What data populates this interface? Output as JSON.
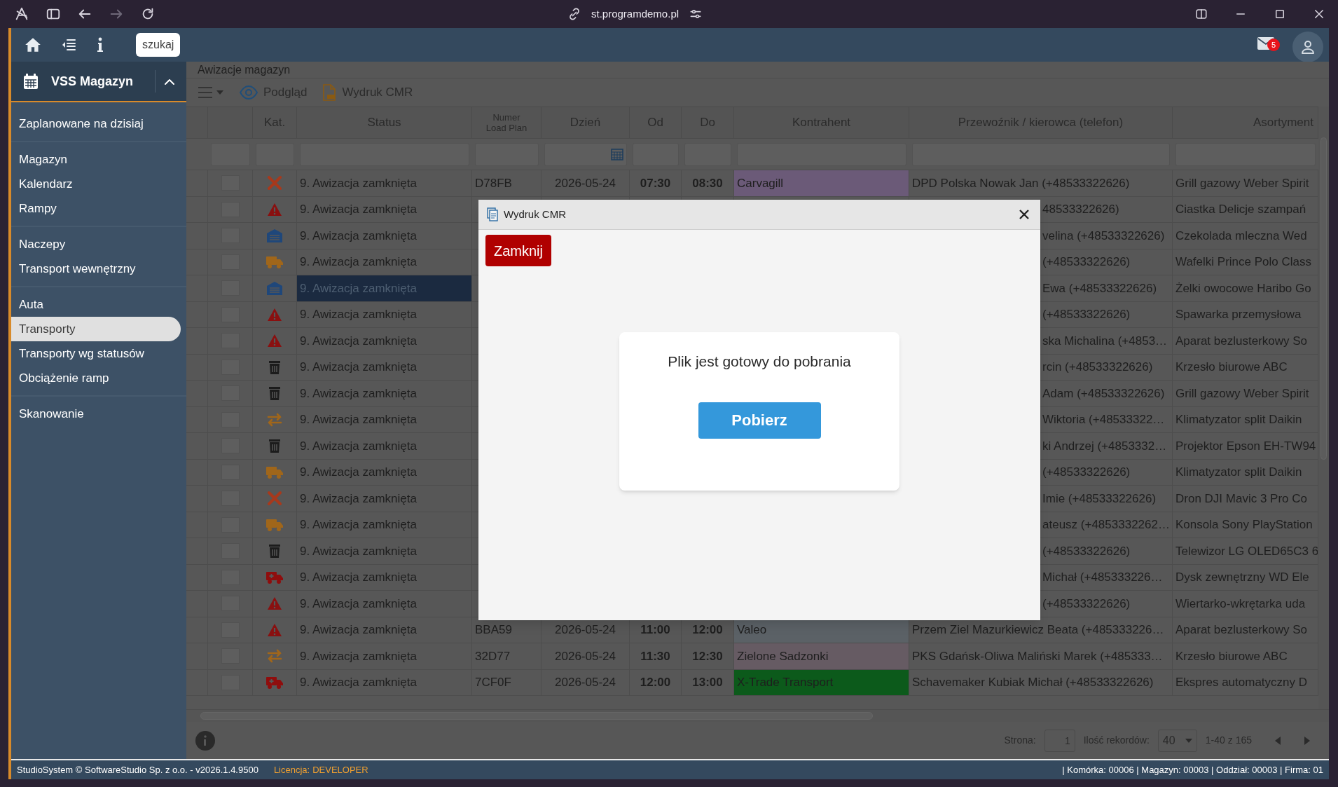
{
  "browser": {
    "url": "st.programdemo.pl"
  },
  "topbar": {
    "search_button": "szukaj",
    "mail_badge": "5"
  },
  "sidebar": {
    "title": "VSS Magazyn",
    "expanded": true,
    "groups": [
      [
        {
          "label": "Zaplanowane na dzisiaj",
          "selected": false
        }
      ],
      [
        {
          "label": "Magazyn",
          "selected": false
        },
        {
          "label": "Kalendarz",
          "selected": false
        },
        {
          "label": "Rampy",
          "selected": false
        }
      ],
      [
        {
          "label": "Naczepy",
          "selected": false
        },
        {
          "label": "Transport wewnętrzny",
          "selected": false
        }
      ],
      [
        {
          "label": "Auta",
          "selected": false
        },
        {
          "label": "Transporty",
          "selected": true
        },
        {
          "label": "Transporty wg statusów",
          "selected": false
        },
        {
          "label": "Obciążenie ramp",
          "selected": false
        }
      ],
      [
        {
          "label": "Skanowanie",
          "selected": false
        }
      ]
    ]
  },
  "page": {
    "title": "Awizacje magazyn",
    "toolbar": [
      {
        "kind": "eye",
        "label": "Podgląd"
      },
      {
        "kind": "pdf",
        "label": "Wydruk CMR"
      }
    ]
  },
  "table": {
    "columns": [
      "Kat.",
      "Status",
      "Numer Load Plan",
      "Dzień",
      "Od",
      "Do",
      "Kontrahent",
      "Przewoźnik / kierowca (telefon)",
      "Asortyment"
    ],
    "rows": [
      {
        "kind": "tools",
        "checked": false,
        "status": "9. Awizacja zamknięta",
        "selected": false,
        "numer": "D78FB",
        "dzien": "2026-05-24",
        "od": "07:30",
        "do": "08:30",
        "kontrahent": {
          "name": "Carvagill",
          "color": "#6b5a78"
        },
        "przewoznik": "DPD Polska Nowak Jan (+48533322626)",
        "asortyment": "Grill gazowy Weber Spirit"
      },
      {
        "kind": "warning",
        "checked": false,
        "status": "9. Awizacja zamknięta",
        "selected": false,
        "przewoznik": "48533322626)",
        "asortyment": "Ciastka Delicje szampań"
      },
      {
        "kind": "garage",
        "checked": false,
        "status": "9. Awizacja zamknięta",
        "selected": false,
        "przewoznik": "velina (+48533322626)",
        "asortyment": "Czekolada mleczna Wed"
      },
      {
        "kind": "truck",
        "checked": false,
        "status": "9. Awizacja zamknięta",
        "selected": false,
        "przewoznik": "(+48533322626)",
        "asortyment": "Wafelki Prince Polo Class"
      },
      {
        "kind": "garage",
        "checked": false,
        "status": "9. Awizacja zamknięta",
        "selected": true,
        "przewoznik": "Ewa (+48533322626)",
        "asortyment": "Żelki owocowe Haribo Go"
      },
      {
        "kind": "warning",
        "checked": false,
        "status": "9. Awizacja zamknięta",
        "selected": false,
        "przewoznik": "(+48533322626)",
        "asortyment": "Spawarka przemysłowa"
      },
      {
        "kind": "warning",
        "checked": false,
        "status": "9. Awizacja zamknięta",
        "selected": false,
        "przewoznik": "ska Michalina (+4853…",
        "asortyment": "Aparat bezlusterkowy So"
      },
      {
        "kind": "trash",
        "checked": false,
        "status": "9. Awizacja zamknięta",
        "selected": false,
        "przewoznik": "rcin (+48533322626)",
        "asortyment": "Krzesło biurowe ABC"
      },
      {
        "kind": "trash",
        "checked": false,
        "status": "9. Awizacja zamknięta",
        "selected": false,
        "przewoznik": "Adam (+48533322626)",
        "asortyment": "Grill gazowy Weber Spirit"
      },
      {
        "kind": "arrows",
        "checked": false,
        "status": "9. Awizacja zamknięta",
        "selected": false,
        "przewoznik": "Wiktoria (+48533322…",
        "asortyment": "Klimatyzator split Daikin"
      },
      {
        "kind": "trash",
        "checked": false,
        "status": "9. Awizacja zamknięta",
        "selected": false,
        "przewoznik": "ki Andrzej (+4853332…",
        "asortyment": "Projektor Epson EH-TW94"
      },
      {
        "kind": "truck",
        "checked": false,
        "status": "9. Awizacja zamknięta",
        "selected": false,
        "przewoznik": "(+48533322626)",
        "asortyment": "Klimatyzator split Daikin"
      },
      {
        "kind": "tools",
        "checked": false,
        "status": "9. Awizacja zamknięta",
        "selected": false,
        "przewoznik": "Imie (+48533322626)",
        "asortyment": "Dron DJI Mavic 3 Pro Co"
      },
      {
        "kind": "truck",
        "checked": false,
        "status": "9. Awizacja zamknięta",
        "selected": false,
        "przewoznik": "ateusz (+4853332262…",
        "asortyment": "Konsola Sony PlayStation"
      },
      {
        "kind": "trash",
        "checked": false,
        "status": "9. Awizacja zamknięta",
        "selected": false,
        "przewoznik": "(+48533322626)",
        "asortyment": "Telewizor LG OLED65C3 6"
      },
      {
        "kind": "ambulance",
        "checked": false,
        "status": "9. Awizacja zamknięta",
        "selected": false,
        "przewoznik": "Michał (+485333226…",
        "asortyment": "Dysk zewnętrzny WD Ele"
      },
      {
        "kind": "warning",
        "checked": false,
        "status": "9. Awizacja zamknięta",
        "selected": false,
        "przewoznik": "(+48533322626)",
        "asortyment": "Wiertarko-wkrętarka uda"
      },
      {
        "kind": "warning",
        "checked": false,
        "status": "9. Awizacja zamknięta",
        "selected": false,
        "numer": "BBA59",
        "dzien": "2026-05-24",
        "od": "11:00",
        "do": "12:00",
        "kontrahent": {
          "name": "Valeo",
          "color": "#5b6166"
        },
        "przewoznik": "Przem Ziel Mazurkiewicz Beata (+485333226…",
        "asortyment": "Aparat bezlusterkowy So"
      },
      {
        "kind": "arrows",
        "checked": false,
        "status": "9. Awizacja zamknięta",
        "selected": false,
        "numer": "32D77",
        "dzien": "2026-05-24",
        "od": "11:30",
        "do": "12:30",
        "kontrahent": {
          "name": "Zielone Sadzonki",
          "color": "#665b63"
        },
        "przewoznik": "PKS Gdańsk-Oliwa Maliński Marek (+485333…",
        "asortyment": "Krzesło biurowe ABC"
      },
      {
        "kind": "ambulance",
        "checked": false,
        "status": "9. Awizacja zamknięta",
        "selected": false,
        "numer": "7CF0F",
        "dzien": "2026-05-24",
        "od": "12:00",
        "do": "13:00",
        "kontrahent": {
          "name": "X-Trade Transport",
          "color": "#0c5a1b"
        },
        "przewoznik": "Schavemaker Kubiak Michał (+48533322626)",
        "asortyment": "Ekspres automatyczny D"
      }
    ]
  },
  "pager": {
    "page_label": "Strona:",
    "page": "1",
    "size_label": "Ilość rekordów:",
    "size": "40",
    "range": "1-40 z 165"
  },
  "status_bar": {
    "copyright": "StudioSystem © SoftwareStudio Sp. z o.o. - v2026.1.4.9500",
    "license_label": "Licencja:",
    "license": "DEVELOPER",
    "info": "| Komórka: 00006 | Magazyn: 00003 | Oddział: 00003 | Firma: 01"
  },
  "dialog": {
    "title": "Wydruk CMR",
    "close_button": "Zamknij",
    "message": "Plik jest gotowy do pobrania",
    "download_button": "Pobierz"
  }
}
